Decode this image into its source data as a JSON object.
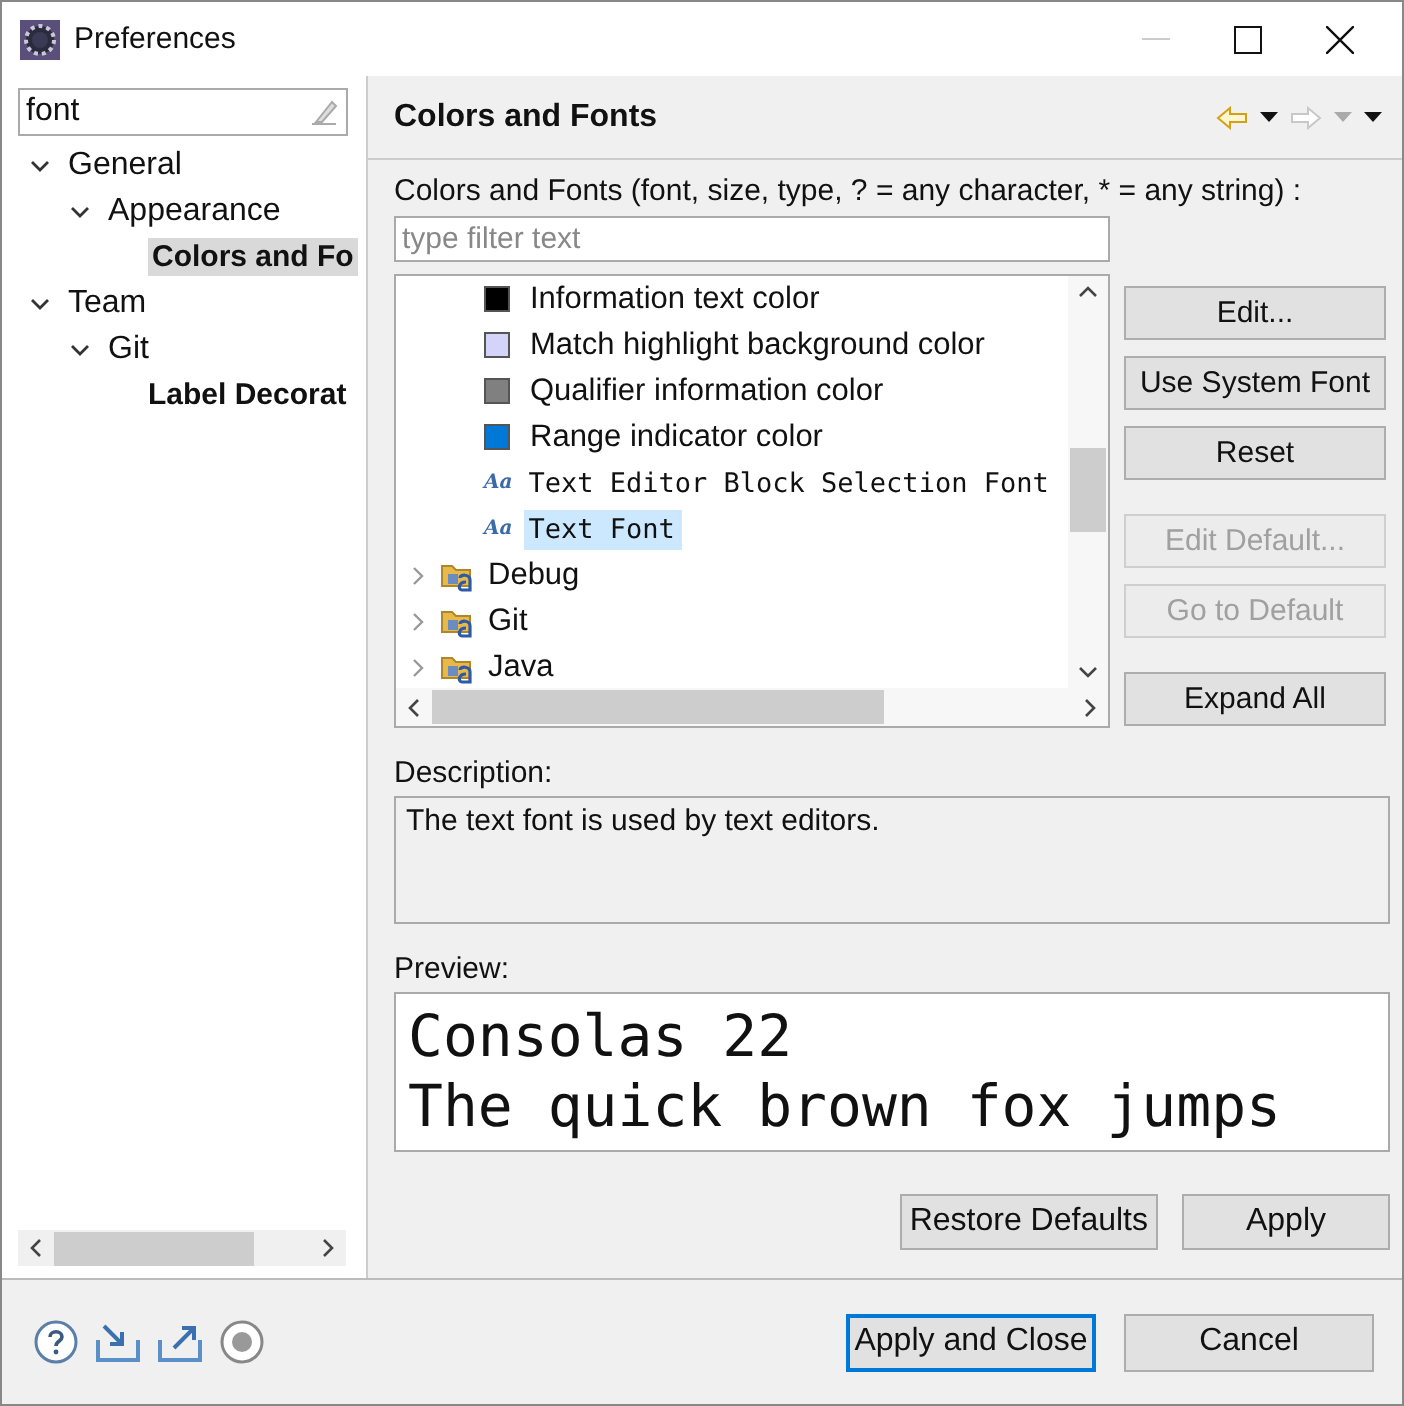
{
  "window": {
    "title": "Preferences"
  },
  "sidebar": {
    "filter": "font",
    "tree": [
      {
        "label": "General",
        "expanded": true,
        "bold": false,
        "selected": false,
        "children": [
          {
            "label": "Appearance",
            "expanded": true,
            "bold": false,
            "selected": false,
            "children": [
              {
                "label": "Colors and Fo",
                "bold": true,
                "selected": true
              }
            ]
          }
        ]
      },
      {
        "label": "Team",
        "expanded": true,
        "bold": false,
        "selected": false,
        "children": [
          {
            "label": "Git",
            "expanded": true,
            "bold": false,
            "selected": false,
            "children": [
              {
                "label": "Label Decorat",
                "bold": true,
                "selected": false
              }
            ]
          }
        ]
      }
    ]
  },
  "page": {
    "title": "Colors and Fonts",
    "filter_label": "Colors and Fonts (font, size, type, ? = any character, * = any string) :",
    "filter": {
      "placeholder": "type filter text"
    },
    "tree": [
      {
        "kind": "color",
        "label": "Information text color",
        "color": "#000000",
        "selected": false
      },
      {
        "kind": "color",
        "label": "Match highlight background color",
        "color": "#d4d4fa",
        "selected": false
      },
      {
        "kind": "color",
        "label": "Qualifier information color",
        "color": "#808080",
        "selected": false
      },
      {
        "kind": "color",
        "label": "Range indicator color",
        "color": "#0078d7",
        "selected": false
      },
      {
        "kind": "font",
        "badge": "Aa",
        "label": "Text Editor Block Selection Font",
        "selected": false
      },
      {
        "kind": "font",
        "badge": "Aa",
        "label": "Text Font",
        "selected": true
      },
      {
        "kind": "category",
        "label": "Debug",
        "expanded": false,
        "selected": false
      },
      {
        "kind": "category",
        "label": "Git",
        "expanded": false,
        "selected": false
      },
      {
        "kind": "category",
        "label": "Java",
        "expanded": false,
        "selected": false
      }
    ],
    "buttons": [
      {
        "label": "Edit...",
        "disabled": false
      },
      {
        "label": "Use System Font",
        "disabled": false
      },
      {
        "label": "Reset",
        "disabled": false
      },
      {
        "label": "Edit Default...",
        "disabled": true
      },
      {
        "label": "Go to Default",
        "disabled": true
      },
      {
        "label": "Expand All",
        "disabled": false
      }
    ],
    "description_label": "Description:",
    "description": "The text font is used by text editors.",
    "preview_label": "Preview:",
    "preview_lines": [
      "Consolas 22",
      "The quick brown fox jumps"
    ],
    "actions": [
      {
        "label": "Restore Defaults"
      },
      {
        "label": "Apply"
      }
    ]
  },
  "footer": {
    "buttons": [
      {
        "label": "Apply and Close",
        "default": true
      },
      {
        "label": "Cancel",
        "default": false
      }
    ]
  }
}
